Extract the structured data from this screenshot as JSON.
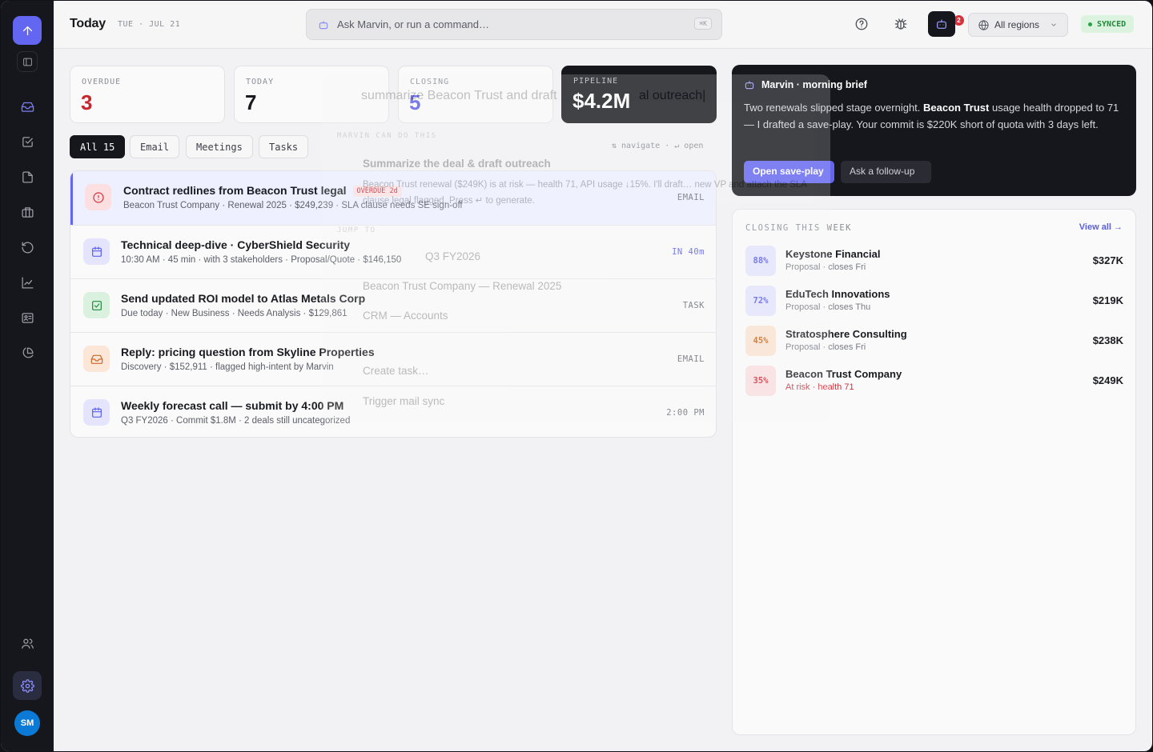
{
  "header": {
    "title": "Today",
    "date": "TUE · JUL 21",
    "command_placeholder": "Ask Marvin, or run a command…",
    "command_shortcut": "⌘K",
    "notif_count": "2",
    "region": "All regions",
    "sync_status": "SYNCED"
  },
  "stats": [
    {
      "label": "OVERDUE",
      "value": "3",
      "color": "#c8262f"
    },
    {
      "label": "TODAY",
      "value": "7",
      "color": "#1a1b20"
    },
    {
      "label": "CLOSING",
      "value": "5",
      "color": "#5b5fe6"
    },
    {
      "label": "PIPELINE",
      "value": "$4.2M",
      "color": "#ffffff"
    }
  ],
  "filters": [
    "All 15",
    "Email",
    "Meetings",
    "Tasks"
  ],
  "nav_hint": "⇅ navigate · ↵ open",
  "feed": [
    {
      "title": "Contract redlines from Beacon Trust legal",
      "badge": "OVERDUE 2d",
      "sub": "Beacon Trust Company · Renewal 2025 · $249,239 · SLA clause needs SE sign-off",
      "tag": "EMAIL",
      "icon": "alert-icon"
    },
    {
      "title": "Technical deep-dive · CyberShield Security",
      "sub": "10:30 AM · 45 min · with 3 stakeholders · Proposal/Quote · $146,150",
      "tag": "IN 40m",
      "icon": "calendar-icon"
    },
    {
      "title": "Send updated ROI model to Atlas Metals Corp",
      "sub": "Due today · New Business · Needs Analysis · $129,861",
      "tag": "TASK",
      "icon": "check-square-icon"
    },
    {
      "title": "Reply: pricing question from Skyline Properties",
      "sub": "Discovery · $152,911 · flagged high-intent by Marvin",
      "tag": "EMAIL",
      "icon": "inbox-icon"
    },
    {
      "title": "Weekly forecast call — submit by 4:00 PM",
      "sub": "Q3 FY2026 · Commit $1.8M · 2 deals still uncategorized",
      "tag": "2:00 PM",
      "icon": "calendar-icon"
    }
  ],
  "brief": {
    "title": "Marvin · morning brief",
    "text_a": "Two renewals slipped stage overnight. ",
    "text_b": "Beacon Trust",
    "text_c": " usage health dropped to 71 — I drafted a save-play. Your commit is $220K short of quota with 3 days left.",
    "primary": "Open save-play",
    "secondary": "Ask a follow-up"
  },
  "closing": {
    "title": "CLOSING THIS WEEK",
    "view_all": "View all →",
    "deals": [
      {
        "pct": "88%",
        "name": "Keystone Financial",
        "meta": "Proposal · closes Fri",
        "amount": "$327K"
      },
      {
        "pct": "72%",
        "name": "EduTech Innovations",
        "meta": "Proposal · closes Thu",
        "amount": "$219K"
      },
      {
        "pct": "45%",
        "name": "Stratosphere Consulting",
        "meta": "Proposal · closes Fri",
        "amount": "$238K"
      },
      {
        "pct": "35%",
        "name": "Beacon Trust Company",
        "meta": "At risk · health 71",
        "amount": "$249K"
      }
    ]
  },
  "ghost": {
    "query_a": "summarize Beacon Trust and draft",
    "query_b": "al outreach|",
    "section1": "MARVIN CAN DO THIS",
    "item1": "Summarize the deal & draft outreach",
    "item1_sub": "Beacon Trust renewal ($249K) is at risk — health 71, API usage ↓15%. I'll draft… new VP and attach the SLA clause legal flagged. Press ↵ to generate.",
    "section2": "JUMP TO",
    "item2": "Q3 FY2026",
    "item3": "Beacon Trust Company — Renewal 2025",
    "item4": "CRM — Accounts",
    "item5": "Create task…",
    "item6": "Trigger mail sync"
  },
  "user": {
    "initials": "SM"
  }
}
